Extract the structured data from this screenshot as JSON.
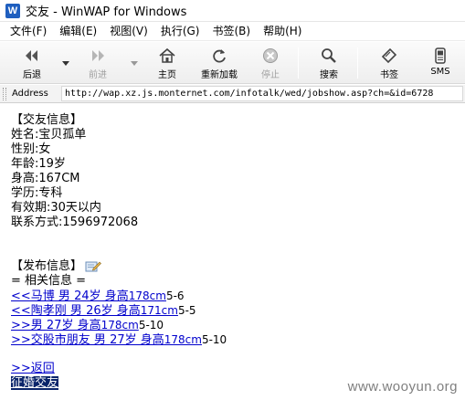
{
  "window": {
    "title": "交友 - WinWAP for Windows",
    "icon_letter": "W"
  },
  "menu": [
    {
      "label": "文件(F)"
    },
    {
      "label": "编辑(E)"
    },
    {
      "label": "视图(V)"
    },
    {
      "label": "执行(G)"
    },
    {
      "label": "书签(B)"
    },
    {
      "label": "帮助(H)"
    }
  ],
  "toolbar": {
    "back": {
      "label": "后退",
      "icon": "back-icon"
    },
    "forward": {
      "label": "前进",
      "icon": "forward-icon"
    },
    "home": {
      "label": "主页",
      "icon": "home-icon"
    },
    "reload": {
      "label": "重新加载",
      "icon": "reload-icon"
    },
    "stop": {
      "label": "停止",
      "icon": "stop-icon"
    },
    "search": {
      "label": "搜索",
      "icon": "search-icon"
    },
    "bookmarks": {
      "label": "书签",
      "icon": "bookmark-icon"
    },
    "sms": {
      "label": "SMS",
      "icon": "sms-icon"
    }
  },
  "address": {
    "label": "Address",
    "url": "http://wap.xz.js.monternet.com/infotalk/wed/jobshow.asp?ch=&id=6728"
  },
  "page": {
    "header": "【交友信息】",
    "fields": [
      "姓名:宝贝孤单",
      "性别:女",
      "年龄:19岁",
      "身高:167CM",
      "学历:专科",
      "有效期:30天以内",
      "联系方式:1596972068"
    ],
    "publish": "【发布信息】",
    "related_header": "= 相关信息 =",
    "related": [
      {
        "prefix": "<<马博 男 ",
        "age": "24岁 身高",
        "height": "178cm",
        "suffix": "5-6"
      },
      {
        "prefix": "<<陶孝刚 男 ",
        "age": "26岁 身高",
        "height": "171cm",
        "suffix": "5-5"
      },
      {
        "prefix": ">>男 ",
        "age": "27岁 身高",
        "height": "178cm",
        "suffix": "5-10"
      },
      {
        "prefix": ">>交股市朋友 男 ",
        "age": "27岁 身高",
        "height": "178cm",
        "suffix": "5-10"
      }
    ],
    "back_link": ">>返回",
    "selected_link": "征婚交友"
  },
  "watermark": "www.wooyun.org",
  "colors": {
    "link": "#0000cc",
    "selection": "#0a246a"
  }
}
